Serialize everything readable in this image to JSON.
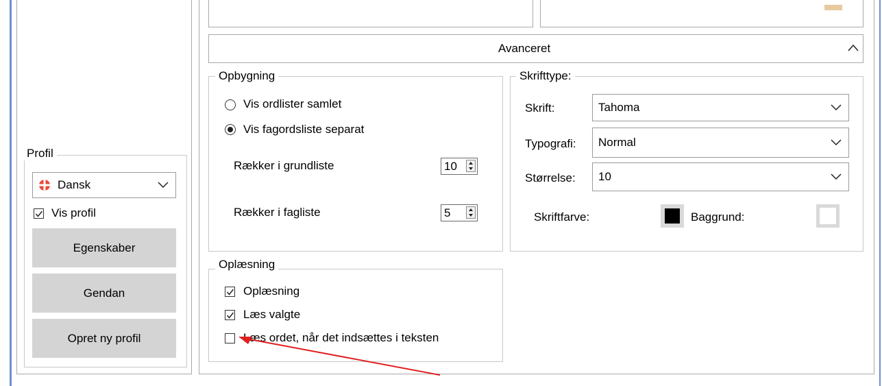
{
  "profile": {
    "legend": "Profil",
    "language": "Dansk",
    "show_profile_label": "Vis profil",
    "show_profile_checked": true,
    "buttons": {
      "properties": "Egenskaber",
      "restore": "Gendan",
      "new_profile": "Opret ny profil"
    }
  },
  "advanced": {
    "header": "Avanceret"
  },
  "structure": {
    "legend": "Opbygning",
    "options": [
      {
        "label": "Vis ordlister samlet",
        "selected": false
      },
      {
        "label": "Vis fagordsliste separat",
        "selected": true
      }
    ],
    "rows_basic_label": "Rækker i grundliste",
    "rows_basic_value": "10",
    "rows_subject_label": "Rækker i fagliste",
    "rows_subject_value": "5"
  },
  "font": {
    "legend": "Skrifttype:",
    "font_label": "Skrift:",
    "font_value": "Tahoma",
    "typography_label": "Typografi:",
    "typography_value": "Normal",
    "size_label": "Størrelse:",
    "size_value": "10",
    "font_color_label": "Skriftfarve:",
    "background_label": "Baggrund:",
    "colors": {
      "font": "#000000",
      "background": "#ffffff"
    }
  },
  "reading": {
    "legend": "Oplæsning",
    "items": [
      {
        "label": "Oplæsning",
        "checked": true
      },
      {
        "label": "Læs valgte",
        "checked": true
      },
      {
        "label": "Læs ordet, når det indsættes i teksten",
        "checked": false
      }
    ]
  },
  "annotation": {
    "arrow_color": "#e02020"
  }
}
